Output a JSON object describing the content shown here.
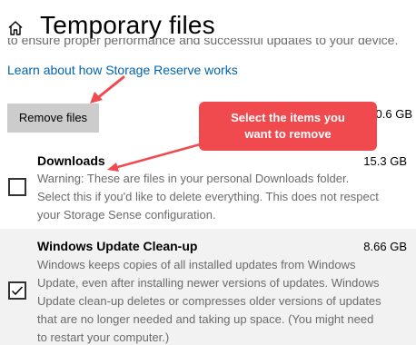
{
  "header": {
    "title": "Temporary files",
    "home_icon": "home-icon",
    "clipped_intro": "to ensure proper performance and successful updates to your device."
  },
  "learn_link": "Learn about how Storage Reserve works",
  "actions": {
    "remove_label": "Remove files",
    "total_selected_size": "0.6 GB"
  },
  "callout": {
    "lines": [
      "Select the items you",
      "want to remove"
    ],
    "color": "#f04a4f"
  },
  "items": [
    {
      "name": "Downloads",
      "size": "15.3 GB",
      "checked": false,
      "description_lines": [
        "Warning: These are files in your personal Downloads folder.",
        "Select this if you'd like to delete everything. This does not respect",
        "your Storage Sense configuration."
      ]
    },
    {
      "name": "Windows Update Clean-up",
      "size": "8.66 GB",
      "checked": true,
      "description_lines": [
        "Windows keeps copies of all installed updates from Windows",
        "Update, even after installing newer versions of updates. Windows",
        "Update clean-up deletes or compresses older versions of updates",
        "that are no longer needed and taking up space. (You might need",
        "to restart your computer.)"
      ]
    }
  ],
  "colors": {
    "accent_link": "#0063b1",
    "button_bg": "#cccccc",
    "selected_row_bg": "#f2f2f2",
    "annotation_red": "#f04a4f"
  }
}
